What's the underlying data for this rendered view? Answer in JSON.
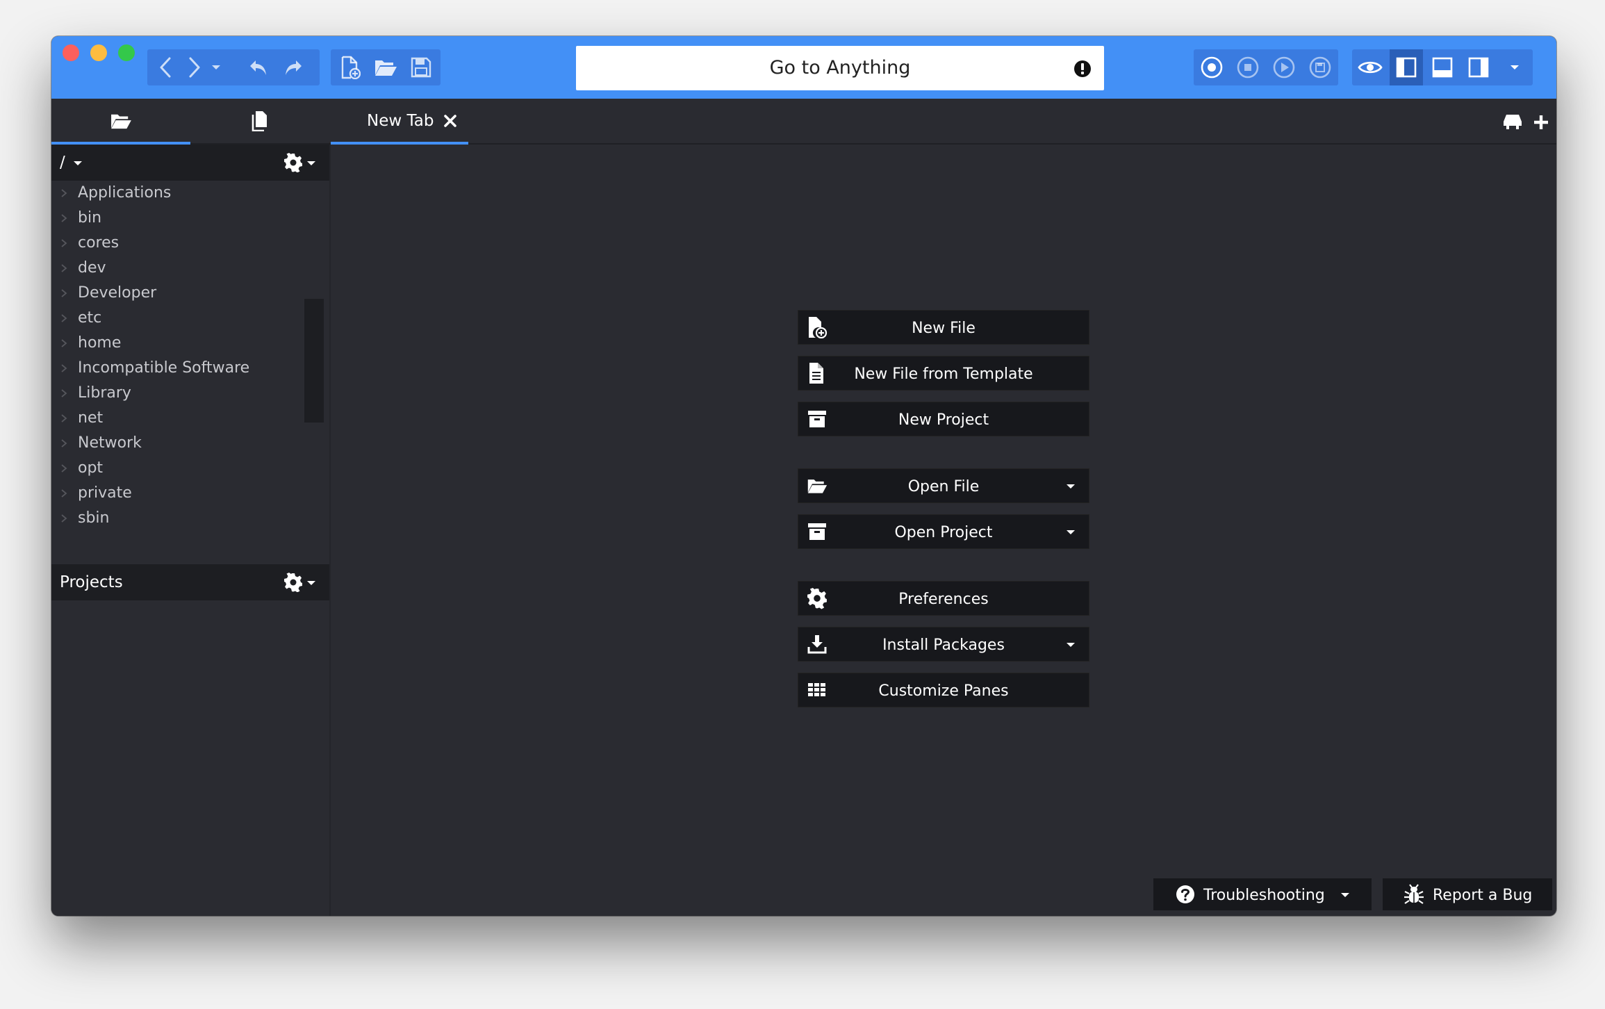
{
  "window": {
    "traffic_lights": [
      "close",
      "minimize",
      "zoom"
    ]
  },
  "toolbar": {
    "nav_icons": [
      "chevron-left-icon",
      "chevron-right-icon",
      "caret-down-icon",
      "undo-icon",
      "redo-icon"
    ],
    "file_icons": [
      "new-file-icon",
      "open-folder-icon",
      "save-icon"
    ],
    "goto_anything": "Go to Anything",
    "macro_icons": [
      "record-icon",
      "stop-icon",
      "play-icon",
      "save-macro-icon"
    ],
    "view_icons": [
      "eye-icon",
      "left-pane-icon",
      "bottom-pane-icon",
      "right-pane-icon",
      "caret-down-icon"
    ],
    "accent_color": "#4390f6"
  },
  "sidebar": {
    "tabs": [
      "folder-icon",
      "files-icon"
    ],
    "path": "/",
    "tree": [
      "Applications",
      "bin",
      "cores",
      "dev",
      "Developer",
      "etc",
      "home",
      "Incompatible Software",
      "Library",
      "net",
      "Network",
      "opt",
      "private",
      "sbin"
    ],
    "projects_label": "Projects"
  },
  "editor": {
    "tab_label": "New Tab"
  },
  "quick_actions": [
    {
      "label": "New File",
      "icon": "new-file-icon",
      "dropdown": false
    },
    {
      "label": "New File from Template",
      "icon": "file-template-icon",
      "dropdown": false
    },
    {
      "label": "New Project",
      "icon": "project-box-icon",
      "dropdown": false
    },
    {
      "label": "Open File",
      "icon": "open-folder-icon",
      "dropdown": true
    },
    {
      "label": "Open Project",
      "icon": "project-box-icon",
      "dropdown": true
    },
    {
      "label": "Preferences",
      "icon": "gear-icon",
      "dropdown": false
    },
    {
      "label": "Install Packages",
      "icon": "download-icon",
      "dropdown": true
    },
    {
      "label": "Customize Panes",
      "icon": "grid-icon",
      "dropdown": false
    }
  ],
  "footer": {
    "troubleshooting": "Troubleshooting",
    "report_bug": "Report a Bug"
  }
}
